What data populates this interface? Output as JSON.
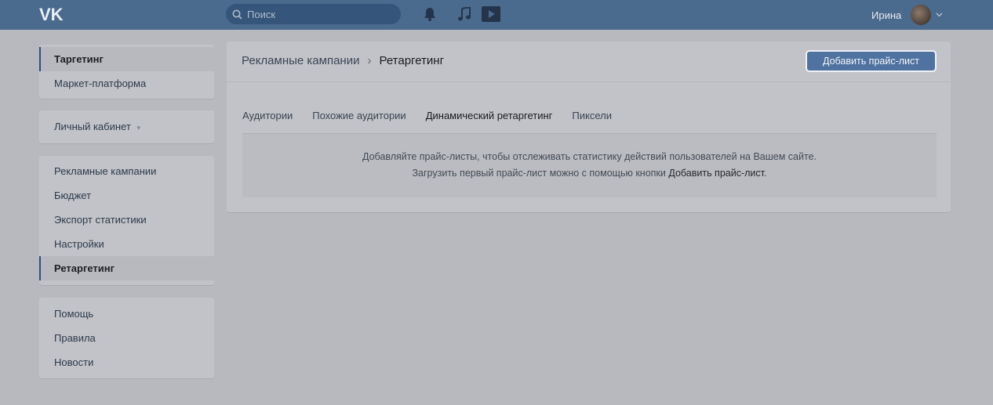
{
  "header": {
    "search_placeholder": "Поиск",
    "user_name": "Ирина"
  },
  "sidebar": {
    "block1": [
      {
        "label": "Таргетинг",
        "active": true
      },
      {
        "label": "Маркет-платформа",
        "active": false
      }
    ],
    "cabinet": {
      "label": "Личный кабинет",
      "caret": "▾"
    },
    "block3": [
      {
        "label": "Рекламные кампании",
        "active": false
      },
      {
        "label": "Бюджет",
        "active": false
      },
      {
        "label": "Экспорт статистики",
        "active": false
      },
      {
        "label": "Настройки",
        "active": false
      },
      {
        "label": "Ретаргетинг",
        "active": true
      }
    ],
    "block4": [
      {
        "label": "Помощь",
        "active": false
      },
      {
        "label": "Правила",
        "active": false
      },
      {
        "label": "Новости",
        "active": false
      }
    ]
  },
  "main": {
    "breadcrumb": {
      "parent": "Рекламные кампании",
      "separator": "›",
      "current": "Ретаргетинг"
    },
    "add_button": "Добавить прайс-лист",
    "tabs": [
      {
        "label": "Аудитории",
        "active": false
      },
      {
        "label": "Похожие аудитории",
        "active": false
      },
      {
        "label": "Динамический ретаргетинг",
        "active": true
      },
      {
        "label": "Пиксели",
        "active": false
      }
    ],
    "notice": {
      "line1": "Добавляйте прайс-листы, чтобы отслеживать статистику действий пользователей на Вашем сайте.",
      "line2_prefix": "Загрузить первый прайс-лист можно с помощью кнопки ",
      "line2_link": "Добавить прайс-лист",
      "line2_suffix": "."
    }
  },
  "colors": {
    "header_bg": "#4a6a8e",
    "page_bg": "#b8b9be",
    "button_bg": "#4f72a0"
  },
  "icons": [
    "vk-logo-icon",
    "search-icon",
    "bell-icon",
    "music-icon",
    "video-icon",
    "chevron-down-icon"
  ]
}
